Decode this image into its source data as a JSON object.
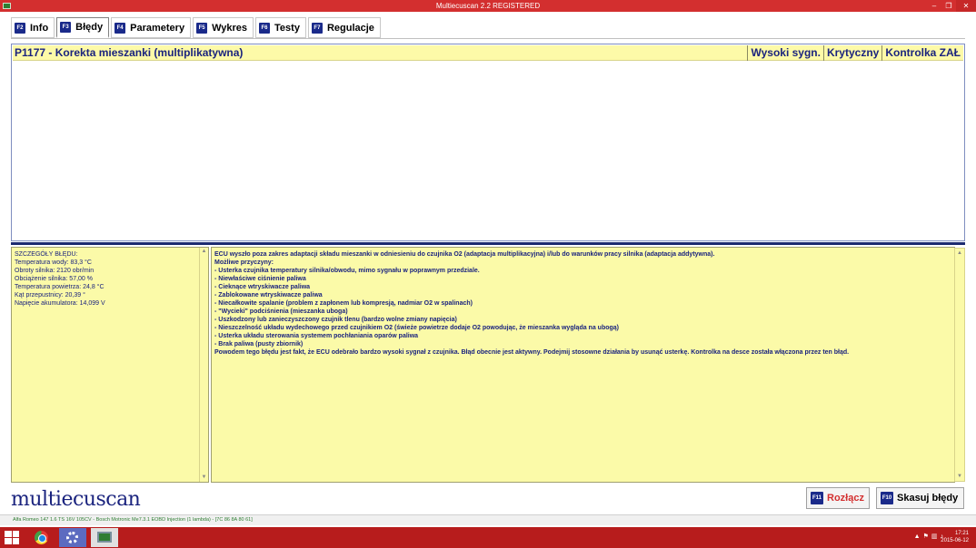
{
  "window": {
    "title": "Multiecuscan 2.2 REGISTERED"
  },
  "tabs": [
    {
      "key": "F2",
      "label": "Info"
    },
    {
      "key": "F3",
      "label": "Błędy"
    },
    {
      "key": "F4",
      "label": "Parametery"
    },
    {
      "key": "F5",
      "label": "Wykres"
    },
    {
      "key": "F6",
      "label": "Testy"
    },
    {
      "key": "F7",
      "label": "Regulacje"
    }
  ],
  "fault": {
    "code_title": "P1177 - Korekta mieszanki (multiplikatywna)",
    "flag_high_signal": "Wysoki sygn.",
    "flag_critical": "Krytyczny",
    "flag_lamp_on": "Kontrolka ZAŁ"
  },
  "details": {
    "heading": "SZCZEGÓŁY BŁĘDU:",
    "lines": [
      "Temperatura wody: 83,3 °C",
      "Obroty silnika: 2120 obr/min",
      "Obciążenie silnika: 57,00 %",
      "Temperatura powietrza: 24,8 °C",
      "Kąt przepustnicy: 20,39 °",
      "Napięcie akumulatora: 14,099 V"
    ]
  },
  "description": {
    "lines": [
      "ECU wyszło poza zakres adaptacji składu mieszanki w odniesieniu do czujnika O2 (adaptacja multiplikacyjna) i/lub do warunków pracy silnika (adaptacja addytywna).",
      "Możliwe przyczyny:",
      "- Usterka czujnika temperatury silnika/obwodu, mimo sygnału w poprawnym przedziale.",
      "- Niewłaściwe ciśnienie paliwa",
      "- Cieknące wtryskiwacze paliwa",
      "- Zablokowane wtryskiwacze paliwa",
      "- Niecałkowite spalanie (problem z zapłonem lub kompresją, nadmiar O2 w spalinach)",
      "- \"Wycieki\" podciśnienia (mieszanka uboga)",
      "- Uszkodzony lub zanieczyszczony czujnik tlenu (bardzo wolne zmiany napięcia)",
      "- Nieszczelność układu wydechowego przed czujnikiem O2 (świeże powietrze dodaje O2 powodując, że mieszanka wygląda na ubogą)",
      "- Usterka układu sterowania systemem pochłaniania oparów paliwa",
      "- Brak paliwa (pusty zbiornik)",
      "Powodem tego błędu jest fakt, że ECU odebrało bardzo wysoki sygnał z czujnika. Błąd obecnie jest aktywny. Podejmij stosowne działania by usunąć usterkę. Kontrolka na desce została włączona przez ten błąd."
    ]
  },
  "logo": {
    "text": "multiecuscan"
  },
  "buttons": {
    "disconnect": {
      "key": "F11",
      "label": "Rozłącz"
    },
    "clear": {
      "key": "F10",
      "label": "Skasuj błędy"
    }
  },
  "status": {
    "vehicle": "Alfa Romeo 147 1.6 TS 16V 105CV - Bosch Motronic Me7.3.1 EOBD Injection (1 lambda) - [7C 86 8A 80 61]"
  },
  "taskbar": {
    "time": "17:21",
    "date": "2015-06-12"
  },
  "colors": {
    "titlebar": "#d32f2f",
    "panel_bg": "#fbfaa8",
    "text_blue": "#1a237e",
    "accent_red": "#d32f2f"
  }
}
